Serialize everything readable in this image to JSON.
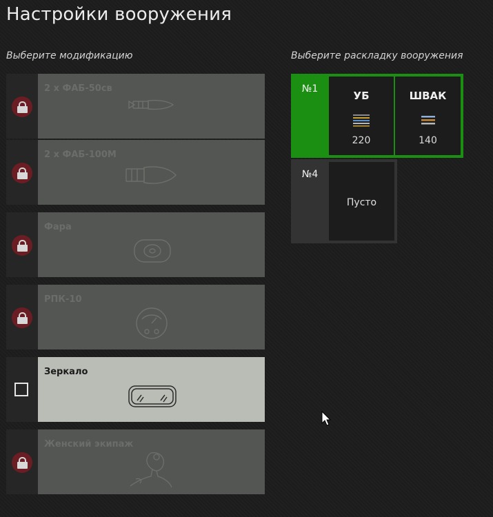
{
  "title": "Настройки вооружения",
  "left_heading": "Выберите модификацию",
  "right_heading": "Выберите раскладку вооружения",
  "modifications": [
    {
      "name": "2 х ФАБ-50св",
      "locked": true,
      "icon": "bomb-icon"
    },
    {
      "name": "2 х ФАБ-100М",
      "locked": true,
      "icon": "large-bomb-icon"
    },
    {
      "name": "Фара",
      "locked": true,
      "icon": "headlight-icon"
    },
    {
      "name": "РПК-10",
      "locked": true,
      "icon": "radio-compass-icon"
    },
    {
      "name": "Зеркало",
      "locked": false,
      "icon": "mirror-icon"
    },
    {
      "name": "Женский экипаж",
      "locked": true,
      "icon": "female-crew-icon"
    }
  ],
  "loadouts": [
    {
      "number": "№1",
      "selected": true,
      "weapons": [
        {
          "name": "УБ",
          "count": "220",
          "icon": "ammo-belt-icon"
        },
        {
          "name": "ШВАК",
          "count": "140",
          "icon": "ammo-belt-icon"
        }
      ]
    },
    {
      "number": "№4",
      "selected": false,
      "empty_label": "Пусто"
    }
  ],
  "colors": {
    "accent": "#1a8f12",
    "selected_card": "#b9bdb6",
    "locked_card": "#545653",
    "lock_badge": "#6b1d24"
  }
}
